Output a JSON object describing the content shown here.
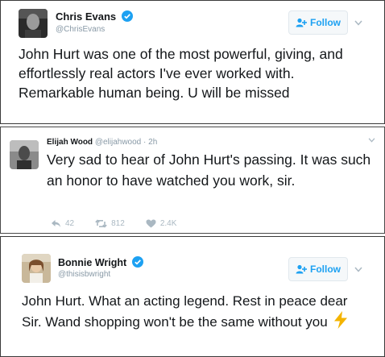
{
  "tweets": [
    {
      "name": "Chris Evans",
      "handle": "@ChrisEvans",
      "verified": true,
      "follow_label": "Follow",
      "text": "John Hurt was one of the most powerful, giving, and effortlessly real actors I've ever worked with. Remarkable human being. U will be missed"
    },
    {
      "name": "Elijah Wood",
      "handle": "@elijahwood",
      "time": "· 2h",
      "text": "Very sad to hear of John Hurt's passing. It was such an honor to have watched you work, sir.",
      "reply_count": "42",
      "retweet_count": "812",
      "like_count": "2.4K"
    },
    {
      "name": "Bonnie Wright",
      "handle": "@thisisbwright",
      "verified": true,
      "follow_label": "Follow",
      "text": "John Hurt. What an acting legend. Rest in peace dear Sir. Wand shopping won't be the same without you",
      "emoji": "⚡"
    }
  ],
  "colors": {
    "twitter_blue": "#1da1f2",
    "muted": "#8899a6",
    "action_gray": "#aab8c2",
    "lightning": "#f4b400"
  },
  "icons": [
    "verified-badge-icon",
    "follow-person-plus-icon",
    "chevron-down-icon",
    "reply-icon",
    "retweet-icon",
    "heart-icon",
    "lightning-emoji"
  ]
}
